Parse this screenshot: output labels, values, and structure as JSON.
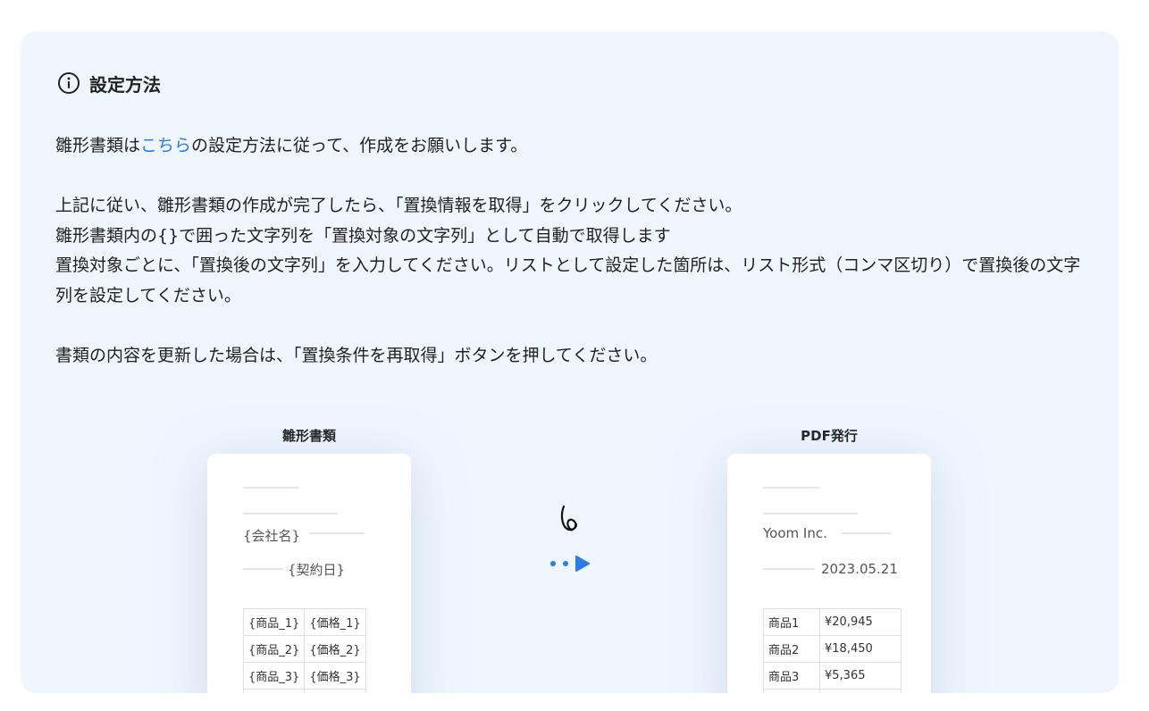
{
  "heading": {
    "icon": "info-icon",
    "title": "設定方法"
  },
  "instructions": {
    "line1": {
      "before": "雛形書類は",
      "link": "こちら",
      "after": "の設定方法に従って、作成をお願いします。"
    },
    "line2": "上記に従い、雛形書類の作成が完了したら、「置換情報を取得」をクリックしてください。",
    "line3": "雛形書類内の{}で囲った文字列を「置換対象の文字列」として自動で取得します",
    "line4": "置換対象ごとに、「置換後の文字列」を入力してください。リストとして設定した箇所は、リスト形式（コンマ区切り）で置換後の文字列を設定してください。",
    "line5": "書類の内容を更新した場合は、「置換条件を再取得」ボタンを押してください。"
  },
  "template_doc": {
    "label": "雛形書類",
    "company": "{会社名}",
    "date": "{契約日}",
    "rows": [
      {
        "item": "{商品_1}",
        "price": "{価格_1}"
      },
      {
        "item": "{商品_2}",
        "price": "{価格_2}"
      },
      {
        "item": "{商品_3}",
        "price": "{価格_3}"
      }
    ]
  },
  "output_doc": {
    "label": "PDF発行",
    "company": "Yoom Inc.",
    "date": "2023.05.21",
    "rows": [
      {
        "item": "商品1",
        "price": "¥20,945"
      },
      {
        "item": "商品2",
        "price": "¥18,450"
      },
      {
        "item": "商品3",
        "price": "¥5,365"
      }
    ]
  },
  "colors": {
    "panel_bg": "#eff6fe",
    "link": "#2b7de9",
    "arrow": "#2b7de9"
  }
}
